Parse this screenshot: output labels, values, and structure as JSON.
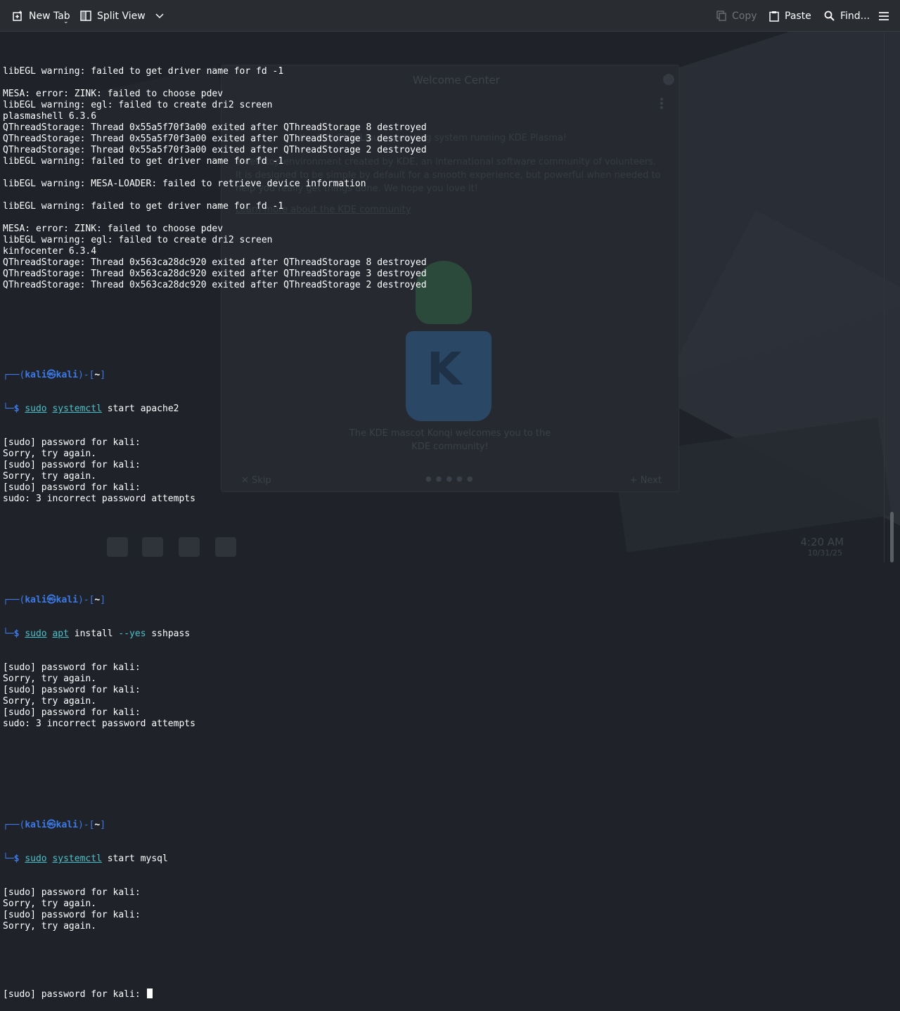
{
  "toolbar": {
    "new_tab": "New Tab",
    "split_view": "Split View",
    "copy": "Copy",
    "paste": "Paste",
    "find": "Find...",
    "icons": {
      "new_tab": "plus-square-icon",
      "split_view": "split-view-icon",
      "copy": "copy-icon",
      "paste": "clipboard-icon",
      "find": "search-icon",
      "menu": "hamburger-menu-icon"
    }
  },
  "background_window": {
    "title": "Welcome Center",
    "line_1": "the Kali GNU/Linux operating system running KDE Plasma!",
    "line_2": "a desktop environment created by KDE, an international software community of volunteers. It is designed to be simple by default for a smooth experience, but powerful when needed to help you really get things done. We hope you love it!",
    "line_3": "Learn more about the KDE community",
    "caption": "The KDE mascot Konqi welcomes you to the KDE community!",
    "skip": "Skip",
    "next": "Next"
  },
  "taskbar": {
    "clock": "4:20 AM",
    "date": "10/31/25"
  },
  "terminal": {
    "prompt": {
      "top": "┌──(",
      "user": "kali㉿kali",
      "mid": ")-[",
      "dir": "~",
      "end": "]",
      "bottom": "└─",
      "dollar": "$ "
    },
    "log_lines": [
      "libEGL warning: failed to get driver name for fd -1",
      "",
      "MESA: error: ZINK: failed to choose pdev",
      "libEGL warning: egl: failed to create dri2 screen",
      "plasmashell 6.3.6",
      "QThreadStorage: Thread 0x55a5f70f3a00 exited after QThreadStorage 8 destroyed",
      "QThreadStorage: Thread 0x55a5f70f3a00 exited after QThreadStorage 3 destroyed",
      "QThreadStorage: Thread 0x55a5f70f3a00 exited after QThreadStorage 2 destroyed",
      "libEGL warning: failed to get driver name for fd -1",
      "",
      "libEGL warning: MESA-LOADER: failed to retrieve device information",
      "",
      "libEGL warning: failed to get driver name for fd -1",
      "",
      "MESA: error: ZINK: failed to choose pdev",
      "libEGL warning: egl: failed to create dri2 screen",
      "kinfocenter 6.3.4",
      "QThreadStorage: Thread 0x563ca28dc920 exited after QThreadStorage 8 destroyed",
      "QThreadStorage: Thread 0x563ca28dc920 exited after QThreadStorage 3 destroyed",
      "QThreadStorage: Thread 0x563ca28dc920 exited after QThreadStorage 2 destroyed",
      ""
    ],
    "commands": [
      {
        "sudo": "sudo",
        "prog": "systemctl",
        "args": " start apache2",
        "opt": "",
        "rest": "",
        "output": [
          "[sudo] password for kali:",
          "Sorry, try again.",
          "[sudo] password for kali:",
          "Sorry, try again.",
          "[sudo] password for kali:",
          "sudo: 3 incorrect password attempts",
          ""
        ]
      },
      {
        "sudo": "sudo",
        "prog": "apt",
        "args": " install ",
        "opt": "--yes",
        "rest": " sshpass",
        "output": [
          "[sudo] password for kali:",
          "Sorry, try again.",
          "[sudo] password for kali:",
          "Sorry, try again.",
          "[sudo] password for kali:",
          "sudo: 3 incorrect password attempts",
          ""
        ]
      },
      {
        "sudo": "sudo",
        "prog": "systemctl",
        "args": " start mysql",
        "opt": "",
        "rest": "",
        "output": [
          "[sudo] password for kali:",
          "Sorry, try again.",
          "[sudo] password for kali:",
          "Sorry, try again."
        ]
      }
    ],
    "current_prompt": "[sudo] password for kali: "
  }
}
